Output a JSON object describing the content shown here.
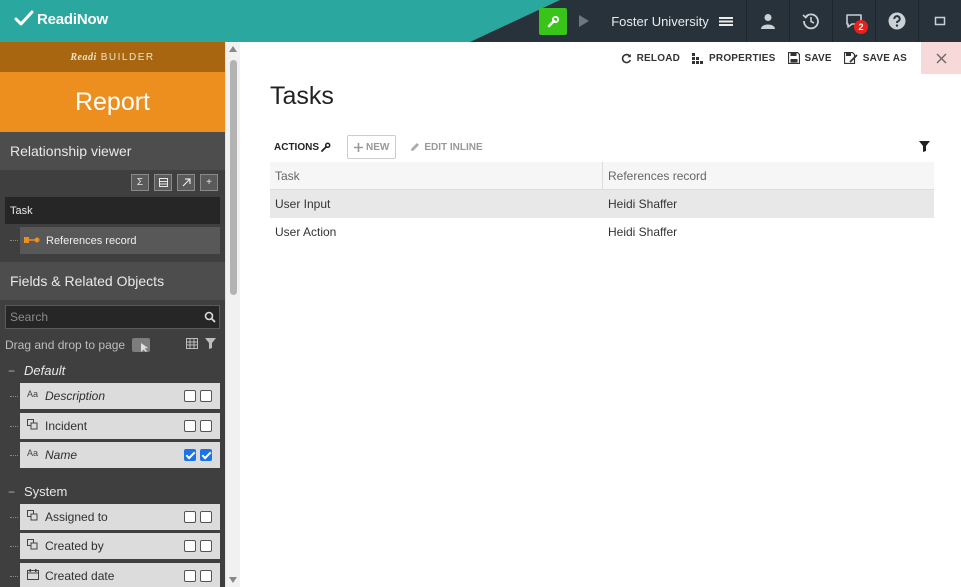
{
  "app": {
    "logo_text": "ReadiNow",
    "tenant": "Foster University",
    "notification_count": "2",
    "accent_color": "#2aa8a0",
    "builder_color": "#39c41a"
  },
  "sidebar": {
    "builder_brand": "Readi",
    "builder_label": "BUILDER",
    "report_label": "Report",
    "relationship_viewer": {
      "title": "Relationship viewer",
      "tools": [
        "sigma-icon",
        "table-icon",
        "arrow-up-right-icon",
        "plus-icon"
      ],
      "root_node": "Task",
      "child_node": "References record"
    },
    "fields": {
      "title": "Fields & Related Objects",
      "search_placeholder": "Search",
      "drag_hint": "Drag and drop to page",
      "groups": [
        {
          "label": "Default",
          "items": [
            {
              "label": "Description",
              "icon": "text-icon",
              "checked1": false,
              "checked2": false,
              "italic": true
            },
            {
              "label": "Incident",
              "icon": "lookup-icon",
              "checked1": false,
              "checked2": false,
              "italic": false
            },
            {
              "label": "Name",
              "icon": "text-icon",
              "checked1": true,
              "checked2": true,
              "italic": true
            }
          ]
        },
        {
          "label": "System",
          "items": [
            {
              "label": "Assigned to",
              "icon": "lookup-icon",
              "checked1": false,
              "checked2": false,
              "italic": false
            },
            {
              "label": "Created by",
              "icon": "lookup-icon",
              "checked1": false,
              "checked2": false,
              "italic": false
            },
            {
              "label": "Created date",
              "icon": "calendar-icon",
              "checked1": false,
              "checked2": false,
              "italic": false
            }
          ]
        }
      ]
    }
  },
  "toolbar": {
    "reload": "RELOAD",
    "properties": "PROPERTIES",
    "save": "SAVE",
    "save_as": "SAVE AS"
  },
  "main": {
    "title": "Tasks",
    "actions_label": "ACTIONS",
    "new_label": "NEW",
    "edit_inline_label": "EDIT INLINE",
    "columns": [
      "Task",
      "References record"
    ],
    "rows": [
      [
        "User Input",
        "Heidi Shaffer"
      ],
      [
        "User Action",
        "Heidi Shaffer"
      ]
    ]
  }
}
